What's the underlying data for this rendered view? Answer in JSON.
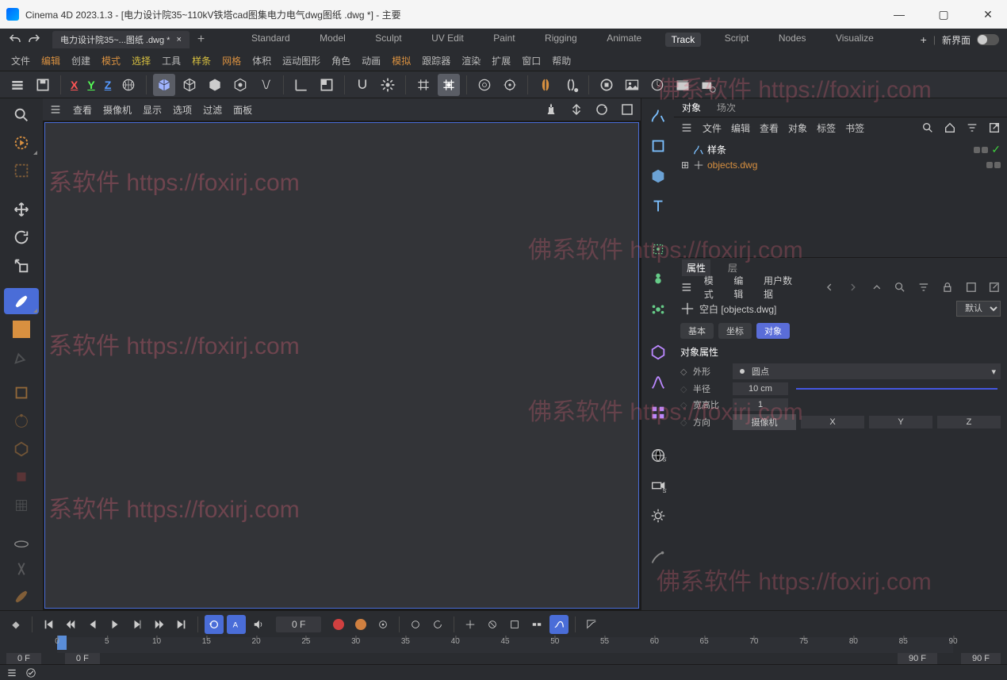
{
  "title": "Cinema 4D 2023.1.3 - [电力设计院35~110kV铁塔cad图集电力电气dwg图纸 .dwg *] - 主要",
  "window": {
    "minimize": "—",
    "maximize": "▢",
    "close": "✕"
  },
  "doctab": {
    "label": "电力设计院35~...图纸 .dwg *",
    "close": "×",
    "add": "+"
  },
  "layouts": [
    "Standard",
    "Model",
    "Sculpt",
    "UV Edit",
    "Paint",
    "Rigging",
    "Animate",
    "Track",
    "Script",
    "Nodes",
    "Visualize"
  ],
  "layouts_active": "Track",
  "topright": {
    "plus": "+",
    "newui": "新界面"
  },
  "menubar": [
    "文件",
    "编辑",
    "创建",
    "模式",
    "选择",
    "工具",
    "样条",
    "网格",
    "体积",
    "运动图形",
    "角色",
    "动画",
    "模拟",
    "跟踪器",
    "渲染",
    "扩展",
    "窗口",
    "帮助"
  ],
  "axis": {
    "x": "X",
    "y": "Y",
    "z": "Z",
    "world": "🌐"
  },
  "viewport_menu": [
    "查看",
    "摄像机",
    "显示",
    "选项",
    "过滤",
    "面板"
  ],
  "panel_tabs": {
    "object": "对象",
    "takes": "场次"
  },
  "panel_bar": [
    "文件",
    "编辑",
    "查看",
    "对象",
    "标签",
    "书签"
  ],
  "tree": {
    "spline": "样条",
    "dwg": "objects.dwg"
  },
  "attr": {
    "tabs": {
      "attr": "属性",
      "layer": "层"
    },
    "menubar": [
      "模式",
      "编辑",
      "用户数据"
    ],
    "object_label": "空白 [objects.dwg]",
    "preset": "默认",
    "subtabs": {
      "basic": "基本",
      "coord": "坐标",
      "object": "对象"
    },
    "section": "对象属性",
    "shape_label": "外形",
    "shape_value": "圆点",
    "radius_label": "半径",
    "radius_value": "10 cm",
    "ratio_label": "宽高比",
    "ratio_value": "1",
    "orient_label": "方向",
    "orient_cam": "摄像机",
    "orient_x": "X",
    "orient_y": "Y",
    "orient_z": "Z"
  },
  "timeline": {
    "current_frame": "0 F",
    "ticks": [
      "0",
      "5",
      "10",
      "15",
      "20",
      "25",
      "30",
      "35",
      "40",
      "45",
      "50",
      "55",
      "60",
      "65",
      "70",
      "75",
      "80",
      "85",
      "90"
    ],
    "range_start": "0 F",
    "range_start2": "0 F",
    "range_end": "90 F",
    "range_end2": "90 F"
  },
  "watermarks": {
    "wm": "佛系软件 https://foxirj.com",
    "partial": "系软件 https://foxirj.com"
  }
}
